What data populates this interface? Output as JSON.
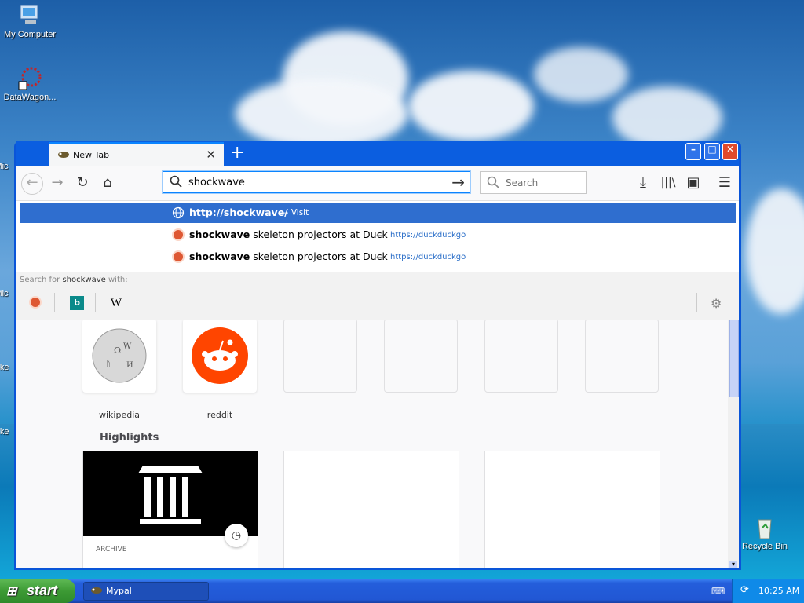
{
  "desktop": {
    "icons": [
      {
        "label": "My Computer"
      },
      {
        "label": "DataWagon..."
      },
      {
        "label": "Mic"
      },
      {
        "label": "Mic"
      },
      {
        "label": "Ske"
      },
      {
        "label": "Ske"
      },
      {
        "label": "Recycle Bin"
      }
    ]
  },
  "browser": {
    "tab": {
      "title": "New Tab"
    },
    "urlbar": {
      "value": "shockwave"
    },
    "searchbox": {
      "placeholder": "Search"
    },
    "popup": {
      "rows": [
        {
          "bold": "http://shockwave/",
          "suffix": " — Visit"
        },
        {
          "bold": "shockwave",
          "rest": " skeleton projectors at Duck",
          "dash": "—",
          "url": "https://duckduckgo"
        },
        {
          "bold": "shockwave",
          "rest": " skeleton projectors at Duck",
          "dash": "—",
          "url": "https://duckduckgo"
        }
      ],
      "search_for_prefix": "Search for ",
      "search_for_term": "shockwave",
      "search_for_suffix": " with:",
      "engines": [
        "duckduckgo-icon",
        "bing-icon",
        "wikipedia-icon"
      ]
    },
    "top_sites": [
      {
        "label": "wikipedia"
      },
      {
        "label": "reddit"
      }
    ],
    "highlights": {
      "title": "Highlights",
      "cards": [
        {
          "label": "ARCHIVE"
        }
      ]
    }
  },
  "taskbar": {
    "start_label": "start",
    "task_label": "Mypal",
    "clock": "10:25 AM"
  },
  "colors": {
    "accent": "#0a84ff",
    "selection": "#2f6ecf",
    "reddit": "#ff4500"
  }
}
